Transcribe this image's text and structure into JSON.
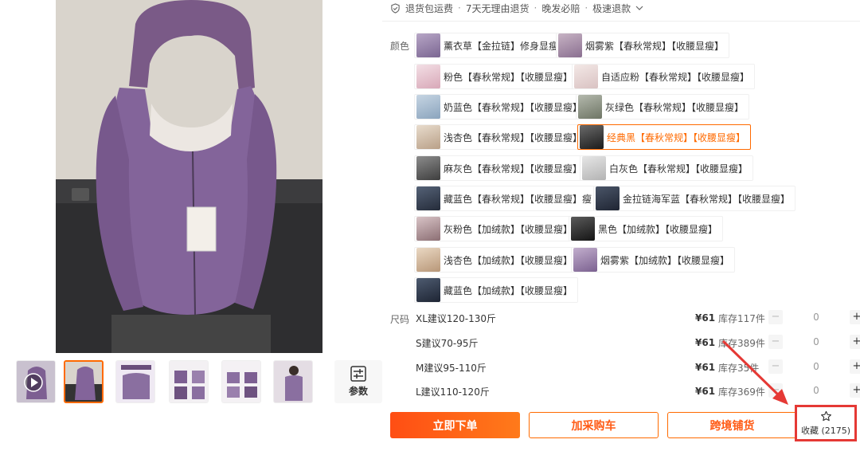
{
  "service": {
    "icon": "shield-check-icon",
    "items": [
      "退货包运费",
      "7天无理由退货",
      "晚发必赔",
      "极速退款"
    ],
    "separator": "·"
  },
  "gallery": {
    "thumbnails": [
      {
        "name": "video-thumbnail",
        "has_play": true
      },
      {
        "name": "image-thumbnail-2",
        "active": true
      },
      {
        "name": "image-thumbnail-3"
      },
      {
        "name": "image-thumbnail-4"
      },
      {
        "name": "image-thumbnail-5"
      },
      {
        "name": "image-thumbnail-6"
      }
    ],
    "params_label": "参数",
    "params_icon": "params-icon"
  },
  "color": {
    "label": "颜色",
    "options": [
      "薰衣草【金拉链】修身显瘦",
      "烟雾紫【春秋常规】【收腰显瘦】",
      "粉色【春秋常规】【收腰显瘦】",
      "自适应粉【春秋常规】【收腰显瘦】",
      "奶蓝色【春秋常规】【收腰显瘦】",
      "灰绿色【春秋常规】【收腰显瘦】",
      "浅杏色【春秋常规】【收腰显瘦】",
      "经典黑【春秋常规】【收腰显瘦】",
      "麻灰色【春秋常规】【收腰显瘦】",
      "白灰色【春秋常规】【收腰显瘦】",
      "藏蓝色【春秋常规】【收腰显瘦】瘦",
      "金拉链海军蓝【春秋常规】【收腰显瘦】",
      "灰粉色【加绒款】【收腰显瘦】",
      "黑色【加绒款】【收腰显瘦】",
      "浅杏色【加绒款】【收腰显瘦】",
      "烟雾紫【加绒款】【收腰显瘦】",
      "藏蓝色【加绒款】【收腰显瘦】"
    ],
    "selected": "经典黑【春秋常规】【收腰显瘦】"
  },
  "size": {
    "label": "尺码",
    "rows": [
      {
        "name": "XL建议120-130斤",
        "price": "¥61",
        "stock": "库存117件",
        "qty": "0"
      },
      {
        "name": "S建议70-95斤",
        "price": "¥61",
        "stock": "库存389件",
        "qty": "0"
      },
      {
        "name": "M建议95-110斤",
        "price": "¥61",
        "stock": "库存35件",
        "qty": "0"
      },
      {
        "name": "L建议110-120斤",
        "price": "¥61",
        "stock": "库存369件",
        "qty": "0"
      }
    ]
  },
  "actions": {
    "buy_now": "立即下单",
    "add_cart": "加采购车",
    "cross_border": "跨境铺货",
    "favorite_label": "收藏 (2175)",
    "favorite_icon": "star-icon"
  },
  "colors": {
    "accent": "#ff6a00",
    "highlight_box": "#e53935"
  }
}
